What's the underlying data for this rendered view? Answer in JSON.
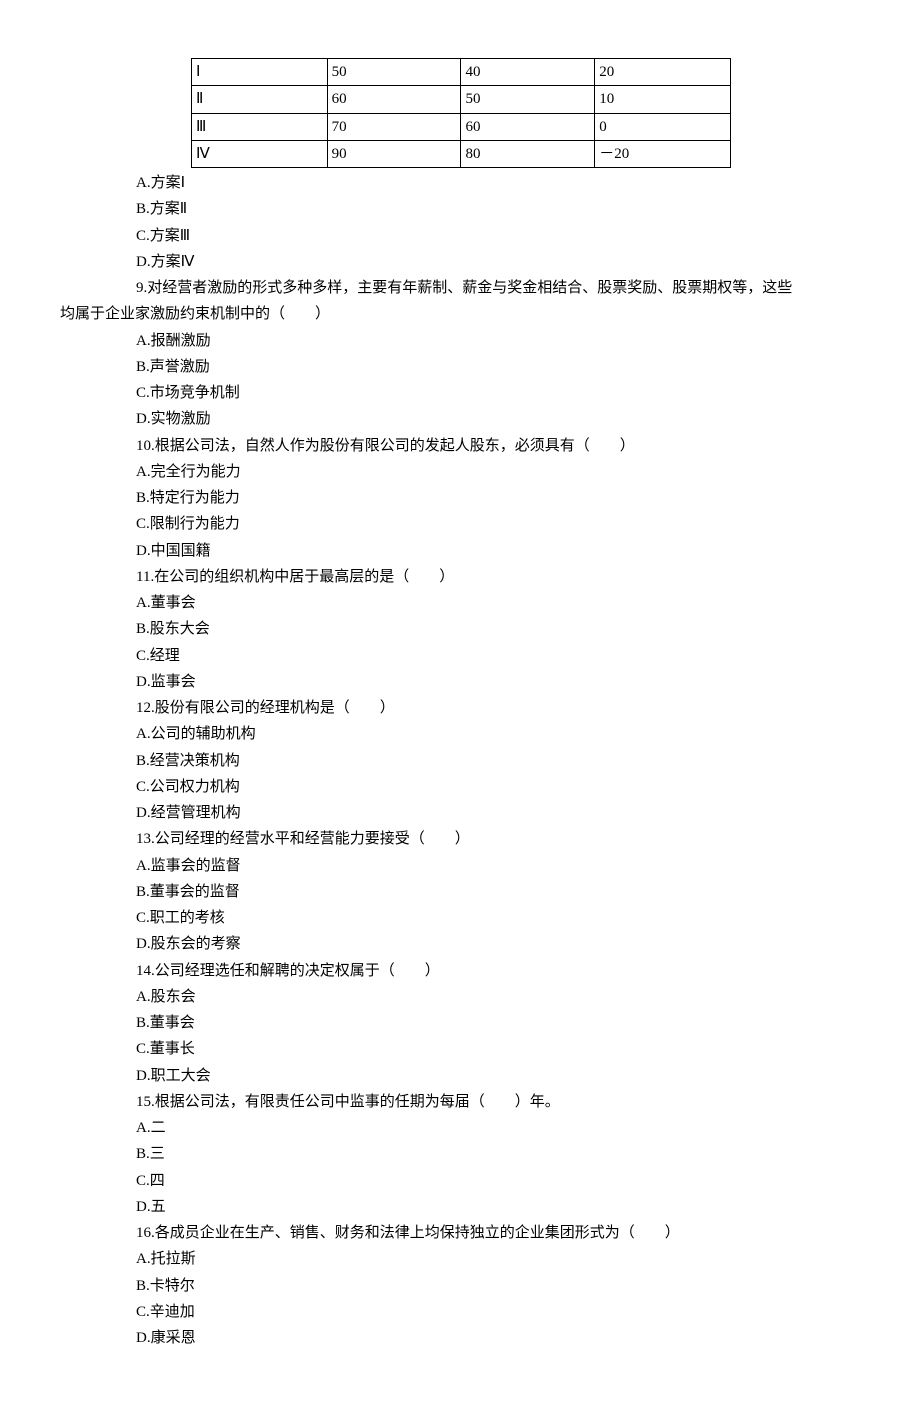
{
  "chart_data": {
    "type": "table",
    "rows": [
      {
        "c1": "Ⅰ",
        "c2": "50",
        "c3": "40",
        "c4": "20"
      },
      {
        "c1": "Ⅱ",
        "c2": "60",
        "c3": "50",
        "c4": "10"
      },
      {
        "c1": "Ⅲ",
        "c2": "70",
        "c3": "60",
        "c4": "0"
      },
      {
        "c1": "Ⅳ",
        "c2": "90",
        "c3": "80",
        "c4": "－20"
      }
    ]
  },
  "q8": {
    "a": "A.方案Ⅰ",
    "b": "B.方案Ⅱ",
    "c": "C.方案Ⅲ",
    "d": "D.方案Ⅳ"
  },
  "q9": {
    "stem1": "9.对经营者激励的形式多种多样，主要有年薪制、薪金与奖金相结合、股票奖励、股票期权等，这些",
    "stem2": "均属于企业家激励约束机制中的（　　）",
    "a": "A.报酬激励",
    "b": "B.声誉激励",
    "c": "C.市场竞争机制",
    "d": "D.实物激励"
  },
  "q10": {
    "stem": "10.根据公司法，自然人作为股份有限公司的发起人股东，必须具有（　　）",
    "a": "A.完全行为能力",
    "b": "B.特定行为能力",
    "c": "C.限制行为能力",
    "d": "D.中国国籍"
  },
  "q11": {
    "stem": "11.在公司的组织机构中居于最高层的是（　　）",
    "a": "A.董事会",
    "b": "B.股东大会",
    "c": "C.经理",
    "d": "D.监事会"
  },
  "q12": {
    "stem": "12.股份有限公司的经理机构是（　　）",
    "a": "A.公司的辅助机构",
    "b": "B.经营决策机构",
    "c": "C.公司权力机构",
    "d": "D.经营管理机构"
  },
  "q13": {
    "stem": "13.公司经理的经营水平和经营能力要接受（　　）",
    "a": "A.监事会的监督",
    "b": "B.董事会的监督",
    "c": "C.职工的考核",
    "d": "D.股东会的考察"
  },
  "q14": {
    "stem": "14.公司经理选任和解聘的决定权属于（　　）",
    "a": "A.股东会",
    "b": "B.董事会",
    "c": "C.董事长",
    "d": "D.职工大会"
  },
  "q15": {
    "stem": "15.根据公司法，有限责任公司中监事的任期为每届（　　）年。",
    "a": "A.二",
    "b": "B.三",
    "c": "C.四",
    "d": "D.五"
  },
  "q16": {
    "stem": "16.各成员企业在生产、销售、财务和法律上均保持独立的企业集团形式为（　　）",
    "a": "A.托拉斯",
    "b": "B.卡特尔",
    "c": "C.辛迪加",
    "d": "D.康采恩"
  }
}
